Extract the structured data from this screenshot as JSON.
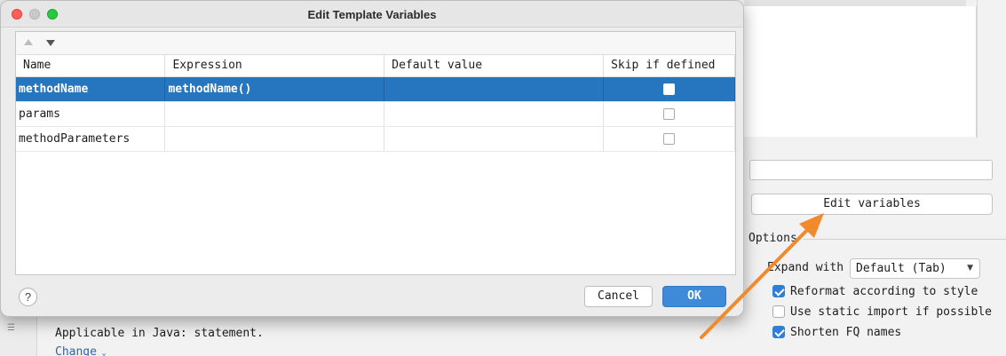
{
  "dialog": {
    "title": "Edit Template Variables",
    "columns": [
      "Name",
      "Expression",
      "Default value",
      "Skip if defined"
    ],
    "rows": [
      {
        "name": "methodName",
        "expression": "methodName()",
        "default_value": "",
        "skip": false,
        "selected": true
      },
      {
        "name": "params",
        "expression": "",
        "default_value": "",
        "skip": false,
        "selected": false
      },
      {
        "name": "methodParameters",
        "expression": "",
        "default_value": "",
        "skip": false,
        "selected": false
      }
    ],
    "help_label": "?",
    "cancel_label": "Cancel",
    "ok_label": "OK"
  },
  "background": {
    "edit_variables_label": "Edit variables",
    "options_title": "Options",
    "expand_with_label": "Expand with",
    "expand_with_value": "Default (Tab)",
    "options": [
      {
        "label": "Reformat according to style",
        "checked": true
      },
      {
        "label": "Use static import if possible",
        "checked": false
      },
      {
        "label": "Shorten FQ names",
        "checked": true
      }
    ],
    "applicable_text": "Applicable in Java: statement.",
    "change_link": "Change"
  },
  "colors": {
    "selection": "#2675bf",
    "ok_button": "#3f8ad8",
    "arrow": "#f08a2c",
    "checkbox_checked": "#2f7fd6"
  }
}
